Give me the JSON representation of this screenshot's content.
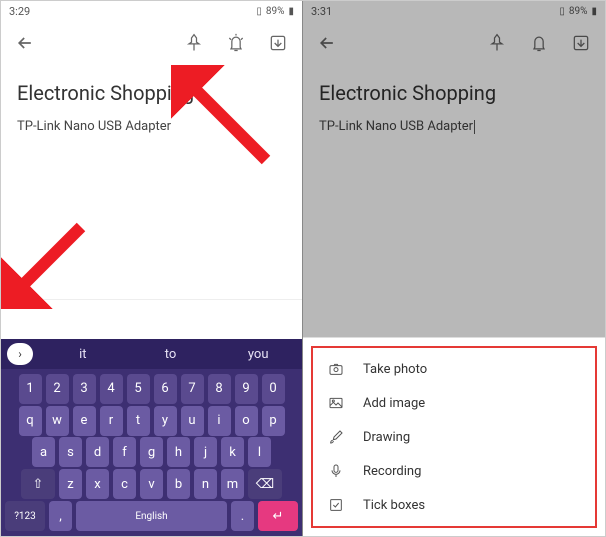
{
  "left": {
    "status": {
      "time": "3:29",
      "battery": "89%"
    },
    "note": {
      "title": "Electronic Shopping",
      "body": "TP-Link Nano USB Adapter"
    },
    "keyboard": {
      "suggestions": [
        "it",
        "to",
        "you"
      ],
      "row_num": [
        "1",
        "2",
        "3",
        "4",
        "5",
        "6",
        "7",
        "8",
        "9",
        "0"
      ],
      "row1": [
        "q",
        "w",
        "e",
        "r",
        "t",
        "y",
        "u",
        "i",
        "o",
        "p"
      ],
      "row2": [
        "a",
        "s",
        "d",
        "f",
        "g",
        "h",
        "j",
        "k",
        "l"
      ],
      "row3_shift": "⇧",
      "row3": [
        "z",
        "x",
        "c",
        "v",
        "b",
        "n",
        "m"
      ],
      "row3_bksp": "⌫",
      "row4": {
        "sym": "?123",
        "comma": ",",
        "space": "English",
        "dot": ".",
        "enter": "↵"
      }
    }
  },
  "right": {
    "status": {
      "time": "3:31",
      "battery": "89%"
    },
    "note": {
      "title": "Electronic Shopping",
      "body": "TP-Link Nano USB Adapter"
    },
    "menu": {
      "take_photo": "Take photo",
      "add_image": "Add image",
      "drawing": "Drawing",
      "recording": "Recording",
      "tick_boxes": "Tick boxes"
    }
  }
}
